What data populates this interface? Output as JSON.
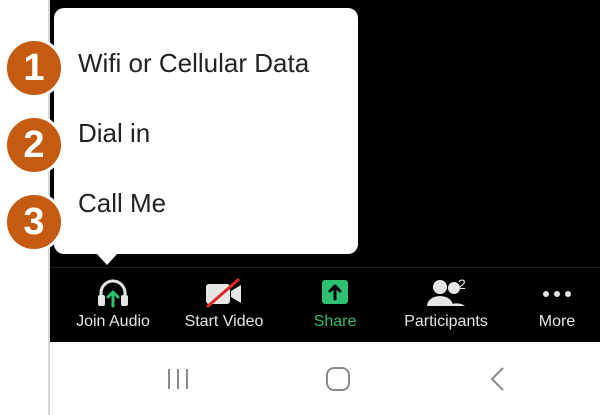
{
  "audio_menu": {
    "options": [
      {
        "number": "1",
        "label": "Wifi or Cellular Data"
      },
      {
        "number": "2",
        "label": "Dial in"
      },
      {
        "number": "3",
        "label": "Call Me"
      }
    ]
  },
  "toolbar": {
    "join_audio": "Join Audio",
    "start_video": "Start Video",
    "share": "Share",
    "participants": "Participants",
    "participants_count": "2",
    "more": "More"
  },
  "colors": {
    "callout": "#c55a11",
    "share_green": "#2fbf71",
    "video_muted_red": "#e02828"
  },
  "icons": {
    "join_audio": "headphones-up-arrow-icon",
    "start_video": "video-camera-off-icon",
    "share": "share-up-arrow-icon",
    "participants": "people-icon",
    "more": "more-dots-icon",
    "recent": "recent-apps-icon",
    "home": "home-icon",
    "back": "back-chevron-icon"
  }
}
